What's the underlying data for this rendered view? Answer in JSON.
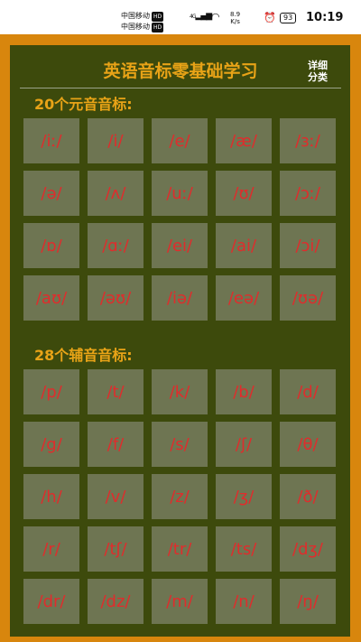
{
  "status_bar": {
    "carrier1": "中国移动",
    "carrier2": "中国移动",
    "hd": "HD",
    "network": "4G",
    "speed_value": "8.9",
    "speed_unit": "K/s",
    "battery": "93",
    "time": "10:19"
  },
  "header": {
    "title": "英语音标零基础学习",
    "detail_line1": "详细",
    "detail_line2": "分类"
  },
  "vowels": {
    "heading": "20个元音音标:",
    "items": [
      "/iː/",
      "/i/",
      "/e/",
      "/æ/",
      "/ɜː/",
      "/ə/",
      "/ʌ/",
      "/uː/",
      "/ʊ/",
      "/ɔː/",
      "/ɒ/",
      "/ɑː/",
      "/ei/",
      "/ai/",
      "/ɔi/",
      "/aʊ/",
      "/əʊ/",
      "/iə/",
      "/eə/",
      "/ʊə/"
    ]
  },
  "consonants": {
    "heading": "28个辅音音标:",
    "items": [
      "/p/",
      "/t/",
      "/k/",
      "/b/",
      "/d/",
      "/g/",
      "/f/",
      "/s/",
      "/ʃ/",
      "/θ/",
      "/h/",
      "/v/",
      "/z/",
      "/ʒ/",
      "/ð/",
      "/r/",
      "/tʃ/",
      "/tr/",
      "/ts/",
      "/dʒ/",
      "/dr/",
      "/dz/",
      "/m/",
      "/n/",
      "/ŋ/"
    ]
  }
}
